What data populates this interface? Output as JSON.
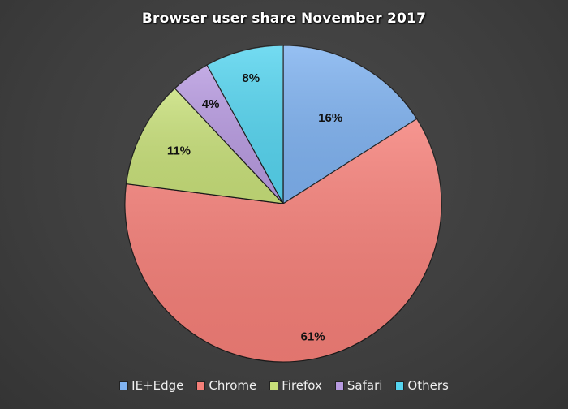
{
  "chart_data": {
    "type": "pie",
    "title": "Browser user share November 2017",
    "categories": [
      "IE+Edge",
      "Chrome",
      "Firefox",
      "Safari",
      "Others"
    ],
    "values": [
      16,
      61,
      11,
      4,
      8
    ],
    "labels": [
      "16%",
      "61%",
      "11%",
      "4%",
      "8%"
    ],
    "colors": [
      "#7fb2f0",
      "#f57f78",
      "#c8e07a",
      "#b79ae0",
      "#55d4ef"
    ],
    "start_angle_deg": 0,
    "direction": "clockwise",
    "legend_position": "bottom"
  }
}
